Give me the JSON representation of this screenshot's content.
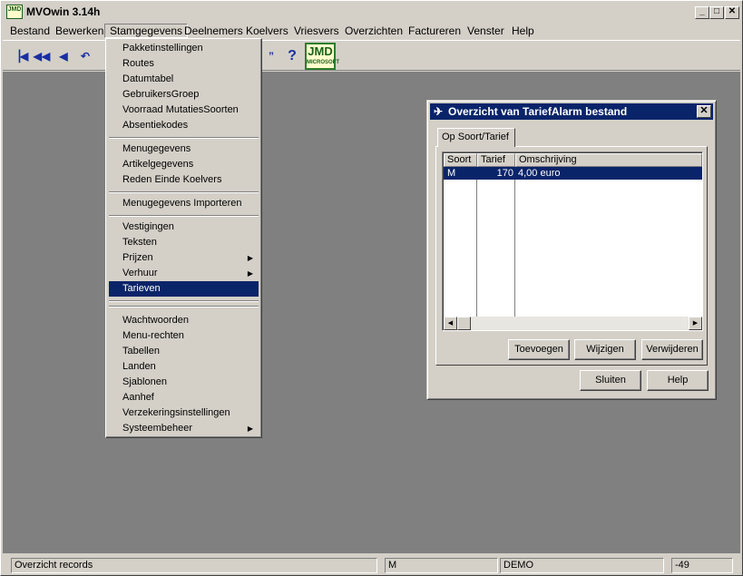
{
  "window": {
    "title": "MVOwin 3.14h",
    "icon_text": "JMD",
    "min": "_",
    "max": "□",
    "close": "✕"
  },
  "menubar": [
    "Bestand",
    "Bewerken",
    "Stamgegevens",
    "Deelnemers",
    "Koelvers",
    "Vriesvers",
    "Overzichten",
    "Factureren",
    "Venster",
    "Help"
  ],
  "toolbar": {
    "logo": "JMD",
    "logo_sub": "MICROSOFT"
  },
  "dropdown": {
    "group1": [
      "Pakketinstellingen",
      "Routes",
      "Datumtabel",
      "GebruikersGroep",
      "Voorraad MutatiesSoorten",
      "Absentiekodes"
    ],
    "group2": [
      "Menugegevens",
      "Artikelgegevens",
      "Reden Einde Koelvers"
    ],
    "group3": [
      "Menugegevens Importeren"
    ],
    "group4": [
      "Vestigingen",
      "Teksten",
      "Prijzen",
      "Verhuur",
      "Tarieven"
    ],
    "group5": [
      "Wachtwoorden",
      "Menu-rechten",
      "Tabellen",
      "Landen",
      "Sjablonen",
      "Aanhef",
      "Verzekeringsinstellingen",
      "Systeembeheer"
    ]
  },
  "dialog": {
    "title": "Overzicht van TariefAlarm bestand",
    "tab": "Op Soort/Tarief",
    "columns": [
      "Soort",
      "Tarief",
      "Omschrijving"
    ],
    "rows": [
      {
        "soort": "M",
        "tarief": "170",
        "omschrijving": "4,00 euro"
      }
    ],
    "buttons": {
      "add": "Toevoegen",
      "edit": "Wijzigen",
      "delete": "Verwijderen",
      "close": "Sluiten",
      "help": "Help"
    }
  },
  "statusbar": {
    "message": "Overzicht records",
    "pane2": "M",
    "pane3": "DEMO",
    "pane4": "-49"
  }
}
